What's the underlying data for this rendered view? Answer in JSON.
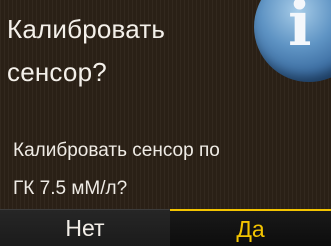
{
  "dialog": {
    "title_line1": "Калибровать",
    "title_line2": "сенсор?",
    "message_line1": "Калибровать сенсор по",
    "message_line2": "ГК 7.5 мМ/л?",
    "info_icon": "info-icon"
  },
  "buttons": {
    "no_label": "Нет",
    "yes_label": "Да"
  },
  "colors": {
    "background": "#2a2016",
    "text": "#f4f0ea",
    "selected_accent": "#f3c400",
    "info_blue": "#5f94c4"
  }
}
